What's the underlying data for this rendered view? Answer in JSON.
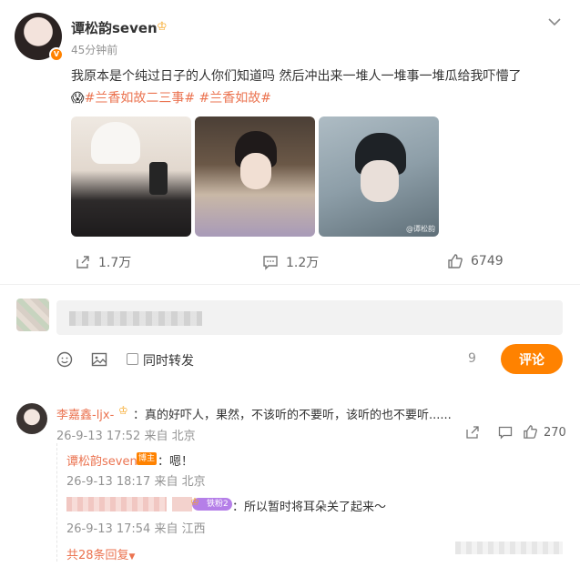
{
  "post": {
    "author": "谭松韵seven",
    "author_badge_icon": "crown-icon",
    "time": "45分钟前",
    "text": "我原本是个纯过日子的人你们知道吗 然后冲出来一堆人一堆事一堆瓜给我吓懵了",
    "emoji": "😱",
    "topics": [
      "#兰香如故二三事#",
      "#兰香如故#"
    ],
    "images": [
      {
        "name": "photo-mirror-selfie"
      },
      {
        "name": "photo-costume-smile"
      },
      {
        "name": "photo-costume-still",
        "watermark": "@谭松韵"
      }
    ],
    "actions": {
      "share_count": "1.7万",
      "comment_count": "1.2万",
      "like_count": "6749"
    }
  },
  "composer": {
    "checkbox_label": "同时转发",
    "char_count": "9",
    "submit_label": "评论"
  },
  "comment": {
    "user": "李嘉鑫-ljx-",
    "text": "：真的好吓人，果然，不该听的不要听，该听的也不要听......",
    "time": "26-9-13 17:52",
    "location": "来自 北京",
    "like_count": "270",
    "replies": [
      {
        "user": "谭松韵seven",
        "tag": "博主",
        "text": "：嗯！",
        "time": "26-9-13 18:17",
        "location": "来自 北京"
      },
      {
        "badge": "铁粉2",
        "text": "：所以暂时将耳朵关了起来～",
        "time": "26-9-13 17:54",
        "location": "来自 江西"
      }
    ],
    "more_replies": "共28条回复"
  },
  "colors": {
    "accent": "#ff8200",
    "link": "#eb7350",
    "muted": "#939393"
  }
}
